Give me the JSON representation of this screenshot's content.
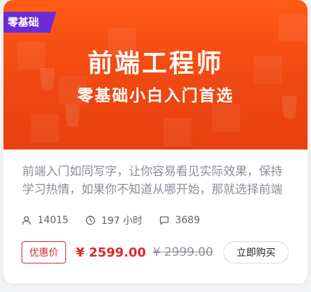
{
  "course": {
    "tag": "零基础",
    "title": "前端工程师",
    "subtitle": "零基础小白入门首选",
    "description": "前端入门如同写字，让你容易看见实际效果，保持学习热情，如果你不知道从哪开始，那就选择前端",
    "stats": {
      "students": "14015",
      "duration": "197 小时",
      "comments": "3689"
    },
    "price_badge": "优惠价",
    "price": "¥ 2599.00",
    "original_price": "¥ 2999.00",
    "buy_label": "立即购买"
  },
  "colors": {
    "banner": "#f04812",
    "tag": "#6a2bd9",
    "price": "#d92b2b"
  }
}
